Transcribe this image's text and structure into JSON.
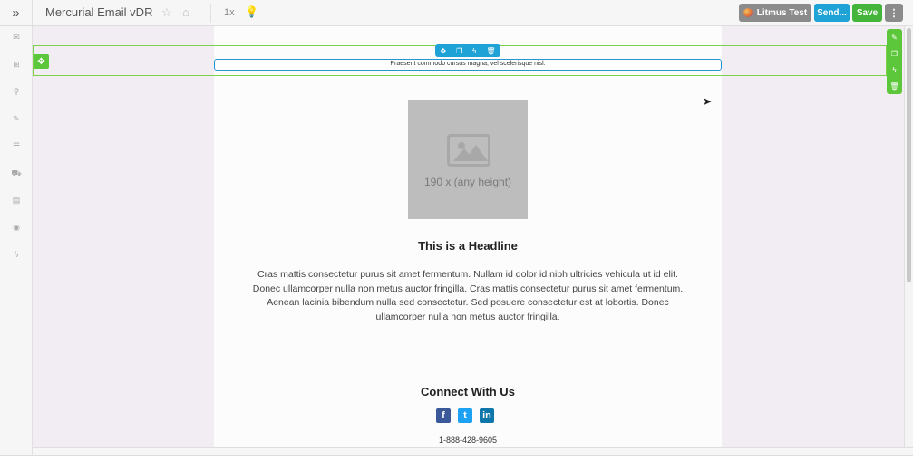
{
  "app": {
    "title": "Mercurial Email vDR",
    "expand_icon": "»",
    "star_icon": "☆",
    "tag_icon": "⌂",
    "zoom": "1x",
    "bulb_icon": "💡"
  },
  "toolbar": {
    "litmus_label": "Litmus Test",
    "send_label": "Send...",
    "save_label": "Save",
    "more_icon": "⋮"
  },
  "sidebar": {
    "items": [
      {
        "name": "email",
        "icon": "✉"
      },
      {
        "name": "layout",
        "icon": "⊞"
      },
      {
        "name": "attachments",
        "icon": "⚲"
      },
      {
        "name": "styles",
        "icon": "✎"
      },
      {
        "name": "rss",
        "icon": "☰"
      },
      {
        "name": "cart",
        "icon": "⛟"
      },
      {
        "name": "document",
        "icon": "▤"
      },
      {
        "name": "preview",
        "icon": "◉"
      },
      {
        "name": "actions",
        "icon": "ϟ"
      }
    ]
  },
  "editor": {
    "move_icon": "✥",
    "row_toolbar": {
      "move": "✥",
      "copy": "❐",
      "action": "ϟ",
      "delete": "🗑"
    },
    "side_toolbar": {
      "edit": "✎",
      "copy": "❐",
      "action": "ϟ",
      "delete": "🗑"
    }
  },
  "email": {
    "preheader": "Praesent commodo cursus magna, vel scelerisque nisl.",
    "image_placeholder": "190 x (any height)",
    "headline": "This is a Headline",
    "body": "Cras mattis consectetur purus sit amet fermentum. Nullam id dolor id nibh ultricies vehicula ut id elit. Donec ullamcorper nulla non metus auctor fringilla. Cras mattis consectetur purus sit amet fermentum. Aenean lacinia bibendum nulla sed consectetur. Sed posuere consectetur est at lobortis. Donec ullamcorper nulla non metus auctor fringilla.",
    "connect_heading": "Connect With Us",
    "social": {
      "facebook": "f",
      "twitter": "t",
      "linkedin": "in"
    },
    "phone": "1-888-428-9605"
  },
  "colors": {
    "accent_blue": "#1fa3d6",
    "accent_green": "#44b53a",
    "selection_green": "#7dd14a",
    "canvas_bg": "#f2ecf3"
  }
}
